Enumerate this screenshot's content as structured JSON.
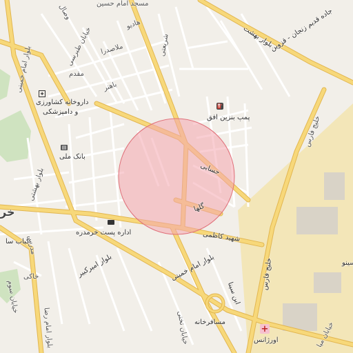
{
  "map": {
    "colors": {
      "background": "#f2efe9",
      "major_road": "#f7d87a",
      "major_road_casing": "#e6b84a",
      "minor_road": "#ffffff",
      "industrial": "#f1e3b3",
      "park": "#cfe3c0",
      "radius_fill": "#f4a6ae",
      "radius_stroke": "#e0707a"
    },
    "street_labels": [
      {
        "id": "masjed-imam-hossein",
        "text": "مسجد امام حسین"
      },
      {
        "id": "hadi-ou",
        "text": "هادیو"
      },
      {
        "id": "vesal",
        "text": "وصال"
      },
      {
        "id": "khiaban-tabarsi",
        "text": "خیابان طبرسی"
      },
      {
        "id": "shariati",
        "text": "شریعتی"
      },
      {
        "id": "bolvar-behesht",
        "text": "بلوار بهشت"
      },
      {
        "id": "jade-qadim-zanjan",
        "text": "جاده قدیم زنجان - قزوین"
      },
      {
        "id": "molasadra",
        "text": "ملاصدرا"
      },
      {
        "id": "moghadam",
        "text": "مقدم"
      },
      {
        "id": "bahonar",
        "text": "باهنر"
      },
      {
        "id": "bolvar-imam-khomeini-w",
        "text": "بلوار امام خمینی"
      },
      {
        "id": "khalij-fars-ne",
        "text": "خلیج فارس"
      },
      {
        "id": "hesabi",
        "text": "حسابی"
      },
      {
        "id": "golha",
        "text": "گلها"
      },
      {
        "id": "shahid-kazemi",
        "text": "شهید کاظمی"
      },
      {
        "id": "bolvar-beheshti",
        "text": "بلوار بهشتی"
      },
      {
        "id": "modares",
        "text": "مدرس"
      },
      {
        "id": "bolvar-amir-kabir",
        "text": "بلوار امیرکبیر"
      },
      {
        "id": "bolvar-imam-khomeini-s",
        "text": "بلوار امام خمینی"
      },
      {
        "id": "ibn-sina",
        "text": "ابن سینا"
      },
      {
        "id": "khalij-fars-s",
        "text": "خلیج فارس"
      },
      {
        "id": "khaki",
        "text": "خاکی"
      },
      {
        "id": "kanal-sevom",
        "text": "خیابان سوم"
      },
      {
        "id": "bolvar-imam-reza",
        "text": "بلوار امام رضا"
      },
      {
        "id": "khiaban-takhti",
        "text": "خیابان تختی"
      },
      {
        "id": "khiaban-mian",
        "text": "خیابان میا"
      }
    ],
    "pois": {
      "fuel_station": "پمپ بنزین افق",
      "agri_pharmacy_line1": "داروخانه کشاورزی",
      "agri_pharmacy_line2": "و دامپزشکی",
      "bank_melli": "بانک ملی",
      "post_office": "اداره پست خرمدره",
      "kabab": "کباب سا",
      "mosaferkhaneh": "مسافرخانه",
      "emergency": "اورژانس",
      "cinema": "سینو",
      "town_fragment": "خر"
    },
    "icons": {
      "fuel": "fuel-pump-icon",
      "bank": "bank-icon",
      "post": "envelope-icon",
      "hospital": "hospital-cross-icon",
      "vet": "pharmacy-icon"
    },
    "search_radius": {
      "shape": "circle"
    }
  }
}
